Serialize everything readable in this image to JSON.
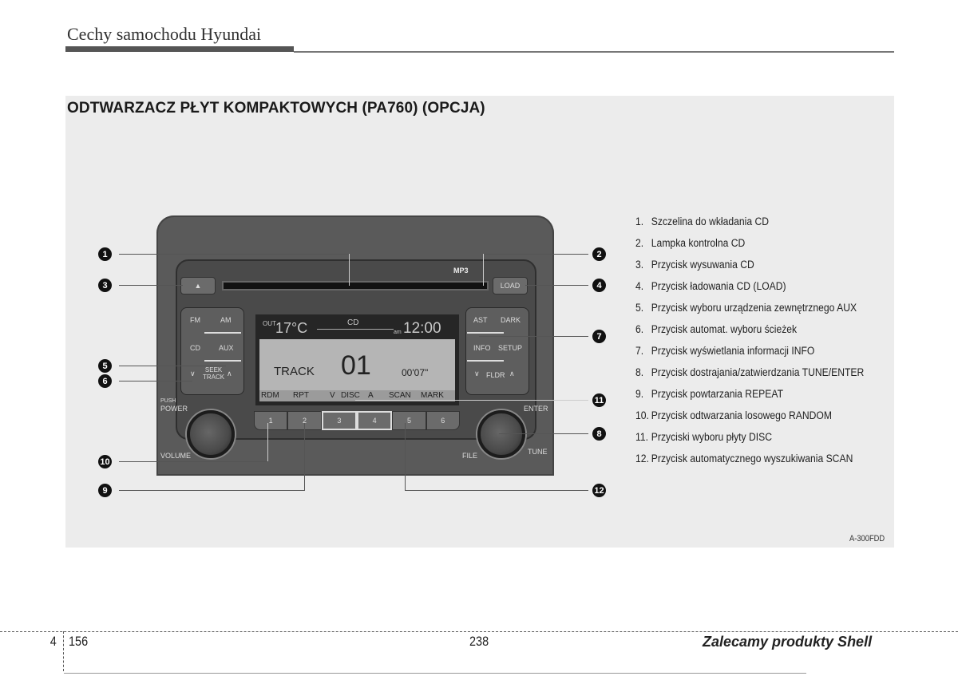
{
  "header": {
    "title": "Cechy samochodu Hyundai"
  },
  "section": {
    "title": "ODTWARZACZ PŁYT KOMPAKTOWYCH (PA760) (OPCJA)"
  },
  "radio": {
    "eject_symbol": "▲",
    "load_label": "LOAD",
    "logos": "MP3",
    "left_buttons": {
      "fm": "FM",
      "am": "AM",
      "cd": "CD",
      "aux": "AUX",
      "seek_top": "SEEK",
      "seek_bottom": "TRACK"
    },
    "right_buttons": {
      "ast": "AST",
      "dark": "DARK",
      "info": "INFO",
      "setup": "SETUP",
      "fldr": "FLDR"
    },
    "display": {
      "out_label": "OUT",
      "temperature": "17°C",
      "source": "CD",
      "am_pm": "am",
      "clock": "12:00",
      "track_label": "TRACK",
      "track_number": "01",
      "elapsed": "00'07\"",
      "soft_keys": [
        "RDM",
        "RPT",
        "V",
        "DISC",
        "A",
        "SCAN",
        "MARK"
      ]
    },
    "presets": [
      "1",
      "2",
      "3",
      "4",
      "5",
      "6"
    ],
    "power_top": "PUSH",
    "power_label": "POWER",
    "volume_label": "VOLUME",
    "enter_label": "ENTER",
    "file_label": "FILE",
    "tune_label": "TUNE"
  },
  "callouts": [
    "1",
    "2",
    "3",
    "4",
    "5",
    "6",
    "7",
    "8",
    "9",
    "10",
    "11",
    "12"
  ],
  "legend": [
    {
      "num": "1.",
      "text": "Szczelina do wkładania CD"
    },
    {
      "num": "2.",
      "text": "Lampka kontrolna CD"
    },
    {
      "num": "3.",
      "text": "Przycisk wysuwania CD"
    },
    {
      "num": "4.",
      "text": "Przycisk ładowania CD (LOAD)"
    },
    {
      "num": "5.",
      "text": "Przycisk wyboru urządzenia zewnętrznego AUX"
    },
    {
      "num": "6.",
      "text": "Przycisk automat. wyboru ścieżek"
    },
    {
      "num": "7.",
      "text": "Przycisk wyświetlania informacji INFO"
    },
    {
      "num": "8.",
      "text": "Przycisk dostrajania/zatwierdzania TUNE/ENTER"
    },
    {
      "num": "9.",
      "text": "Przycisk powtarzania REPEAT"
    },
    {
      "num": "10.",
      "text": "Przycisk odtwarzania losowego RANDOM"
    },
    {
      "num": "11.",
      "text": "Przyciski wyboru płyty DISC"
    },
    {
      "num": "12.",
      "text": "Przycisk automatycznego wyszukiwania SCAN"
    }
  ],
  "figure_code": "A-300FDD",
  "footer": {
    "chapter": "4",
    "page": "156",
    "center": "238",
    "right": "Zalecamy produkty Shell"
  }
}
